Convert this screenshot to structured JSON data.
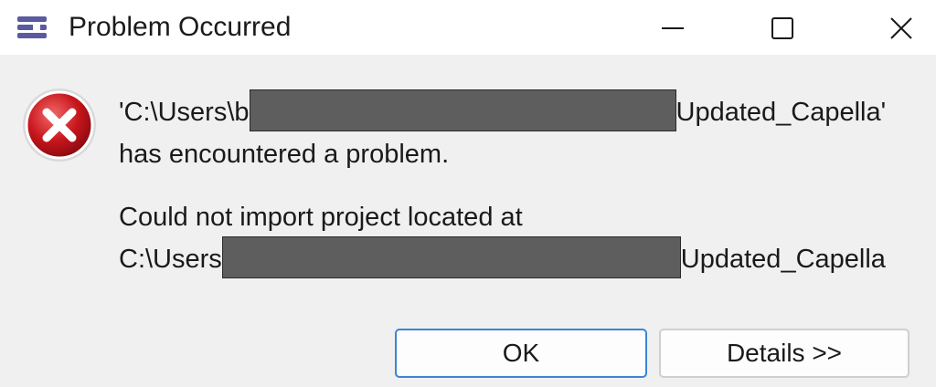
{
  "window": {
    "title": "Problem Occurred",
    "icons": {
      "app": "menu-list-icon",
      "minimize": "minimize-icon",
      "maximize": "maximize-icon",
      "close": "close-icon"
    }
  },
  "dialog": {
    "icon": "error-icon",
    "message1_line1_prefix": "'C:\\Users\\b",
    "message1_line1_suffix": "Updated_Capella'",
    "message1_line2": "has encountered a problem.",
    "message2_line1": "Could not import project located at",
    "message2_line2_prefix": "C:\\Users",
    "message2_line2_suffix": "Updated_Capella"
  },
  "buttons": {
    "ok": "OK",
    "details": "Details >>"
  },
  "colors": {
    "accent": "#3c84d6",
    "error_red": "#c8161d",
    "redaction": "#5e5e5e"
  }
}
